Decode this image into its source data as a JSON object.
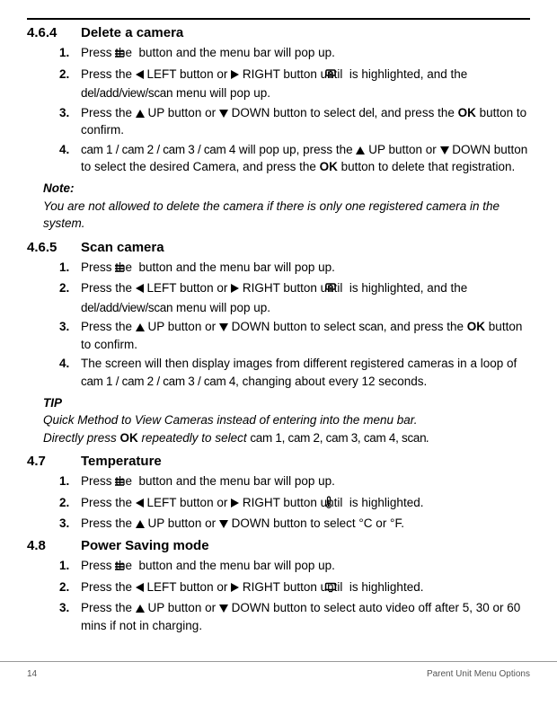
{
  "sections": {
    "s464": {
      "num": "4.6.4",
      "title": "Delete a camera"
    },
    "s465": {
      "num": "4.6.5",
      "title": "Scan camera"
    },
    "s47": {
      "num": "4.7",
      "title": "Temperature"
    },
    "s48": {
      "num": "4.8",
      "title": "Power Saving mode"
    }
  },
  "common": {
    "menu_popup": " button and the menu bar will pop up.",
    "press_the": "Press the ",
    "left_btn": " LEFT button or ",
    "right_btn_until": " RIGHT button until ",
    "up_btn": " UP button or ",
    "down_btn_select": " DOWN button to select ",
    "ok": "OK",
    "confirm": " button to confirm.",
    "highlighted_and": " is highlighted, and the ",
    "menu_will_popup": " menu will pop up.",
    "is_highlighted": " is highlighted."
  },
  "s464": {
    "step3_sel": "del",
    "step3_tail": ", and press the ",
    "step4_cams": "cam 1 / cam 2 / cam 3 / cam 4",
    "step4_mid": " will pop up, press the ",
    "step4_tail": " DOWN button to select the desired Camera, and press the ",
    "step4_end": " button to delete that registration.",
    "dasv": "del/add/view/scan"
  },
  "note": {
    "label": "Note:",
    "body": "You are not allowed to delete the camera if there is only one registered camera in the system."
  },
  "s465": {
    "step3_sel": "scan",
    "step3_tail": ", and press the ",
    "step4_a": "The screen will then display images from different registered cameras in a loop of ",
    "step4_cams": "cam 1 / cam 2 / cam 3 / cam 4",
    "step4_b": ", changing about every 12 seconds.",
    "dasv": "del/add/view/scan"
  },
  "tip": {
    "label": "TIP",
    "line1": "Quick Method to View Cameras instead of entering into the menu bar.",
    "line2a": "Directly press ",
    "line2b": " repeatedly to select ",
    "items": "cam 1, cam 2, cam 3, cam 4, scan",
    "dot": "."
  },
  "s47": {
    "step3_sel": "°C or °F."
  },
  "s48": {
    "step3_tail": " DOWN button to select auto video off after 5, 30 or 60 mins if not in charging."
  },
  "footer": {
    "page": "14",
    "section": "Parent Unit Menu Options"
  }
}
